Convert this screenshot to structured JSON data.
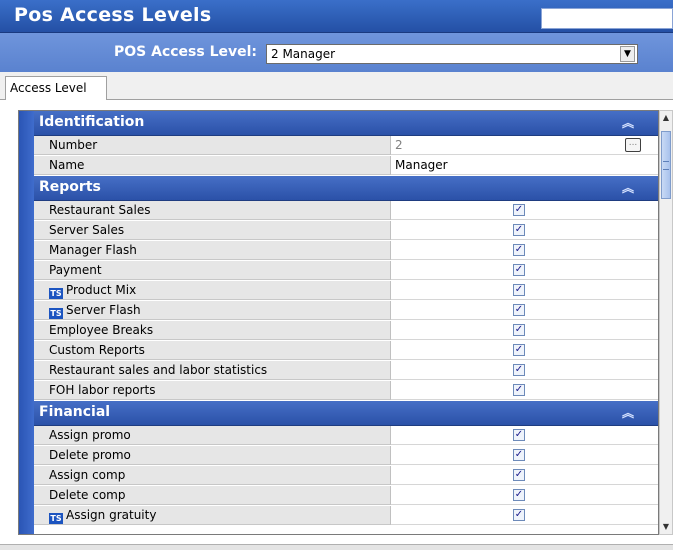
{
  "window": {
    "title": "Pos Access Levels"
  },
  "access_level": {
    "label": "POS Access Level:",
    "selected": "2 Manager"
  },
  "tabs": [
    {
      "label": "Access Level"
    }
  ],
  "sections": [
    {
      "title": "Identification",
      "rows": [
        {
          "label": "Number",
          "value": "2"
        },
        {
          "label": "Name",
          "value": "Manager"
        }
      ]
    },
    {
      "title": "Reports",
      "rows": [
        {
          "label": "Restaurant Sales",
          "checked": true
        },
        {
          "label": "Server Sales",
          "checked": true
        },
        {
          "label": "Manager Flash",
          "checked": true
        },
        {
          "label": "Payment",
          "checked": true
        },
        {
          "label": "Product Mix",
          "checked": true,
          "icon": "ts-icon"
        },
        {
          "label": "Server Flash",
          "checked": true,
          "icon": "ts-icon"
        },
        {
          "label": "Employee Breaks",
          "checked": true
        },
        {
          "label": "Custom Reports",
          "checked": true
        },
        {
          "label": "Restaurant sales and labor statistics",
          "checked": true
        },
        {
          "label": "FOH labor reports",
          "checked": true
        }
      ]
    },
    {
      "title": "Financial",
      "rows": [
        {
          "label": "Assign promo",
          "checked": true
        },
        {
          "label": "Delete promo",
          "checked": true
        },
        {
          "label": "Assign comp",
          "checked": true
        },
        {
          "label": "Delete comp",
          "checked": true
        },
        {
          "label": "Assign gratuity",
          "checked": true,
          "icon": "ts-icon"
        }
      ]
    }
  ],
  "icons": {
    "ts": "TS",
    "collapse": "collapse-up-icon",
    "check": "✓",
    "ellipsis": "...",
    "select_arrow": "▼",
    "scroll_up": "▲",
    "scroll_down": "▼"
  },
  "colors": {
    "title_bar": "#2450a5",
    "level_bar": "#6f95dc",
    "section_header": "#2b51a8",
    "label_cell": "#e6e6e6"
  }
}
